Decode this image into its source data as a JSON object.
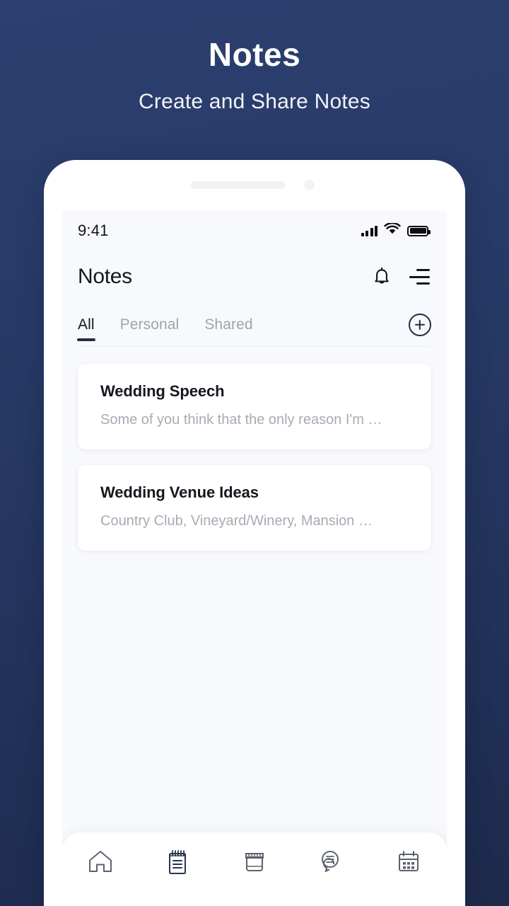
{
  "promo": {
    "title": "Notes",
    "subtitle": "Create and Share Notes"
  },
  "colors": {
    "background_top": "#2c3f70",
    "background_bottom": "#1d2a4c",
    "screen_bg": "#f8f9fc",
    "accent": "#242c45",
    "muted_text": "#a8abb4",
    "title_text": "#15171e"
  },
  "phone": {
    "speaker": "speaker-grille",
    "camera": "front-camera"
  },
  "status_bar": {
    "time": "9:41",
    "icons": [
      "cellular-signal-icon",
      "wifi-icon",
      "battery-icon"
    ]
  },
  "app_bar": {
    "title": "Notes",
    "actions": [
      {
        "name": "notifications-bell-icon"
      },
      {
        "name": "menu-icon"
      }
    ]
  },
  "tabs": {
    "items": [
      {
        "label": "All",
        "active": true
      },
      {
        "label": "Personal",
        "active": false
      },
      {
        "label": "Shared",
        "active": false
      }
    ],
    "add_button": "add-note-icon"
  },
  "notes": [
    {
      "title": "Wedding Speech",
      "preview": "Some of you think that the only reason I'm …"
    },
    {
      "title": "Wedding Venue Ideas",
      "preview": "Country Club, Vineyard/Winery, Mansion …"
    }
  ],
  "bottom_nav": {
    "items": [
      {
        "name": "home-icon",
        "active": false
      },
      {
        "name": "notepad-icon",
        "active": true
      },
      {
        "name": "store-icon",
        "active": false
      },
      {
        "name": "chat-icon",
        "active": false
      },
      {
        "name": "calendar-icon",
        "active": false
      }
    ]
  }
}
